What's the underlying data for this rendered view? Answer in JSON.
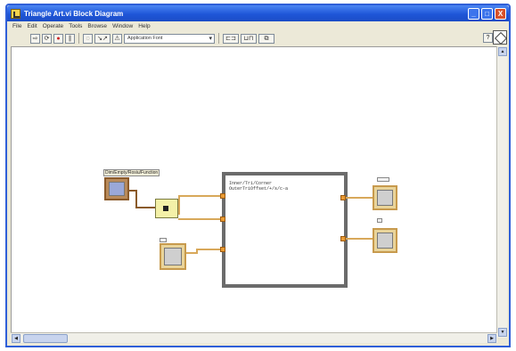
{
  "window": {
    "title": "Triangle Art.vi Block Diagram",
    "controls": [
      "_",
      "□",
      "X"
    ]
  },
  "menu": [
    "File",
    "Edit",
    "Operate",
    "Tools",
    "Browse",
    "Window",
    "Help"
  ],
  "toolbar": {
    "run_icon": "run-arrow-icon",
    "font_select": "Application Font",
    "help_label": "?"
  },
  "diagram": {
    "subvi_label": "Dim/Empty/Rosiu/Function",
    "formula": "Inner/Tri/Corner\nOuterTriOffset/+/s/c-a",
    "indicator1_label": "",
    "indicator2_label": "",
    "control_label": ""
  },
  "scroll": {
    "up": "▲",
    "down": "▼",
    "left": "◀",
    "right": "▶"
  },
  "colors": {
    "title_bar": "#1f56d8",
    "wire": "#d8a85a",
    "structure_border": "#6b6b6b",
    "terminal": "#c79a4d"
  }
}
